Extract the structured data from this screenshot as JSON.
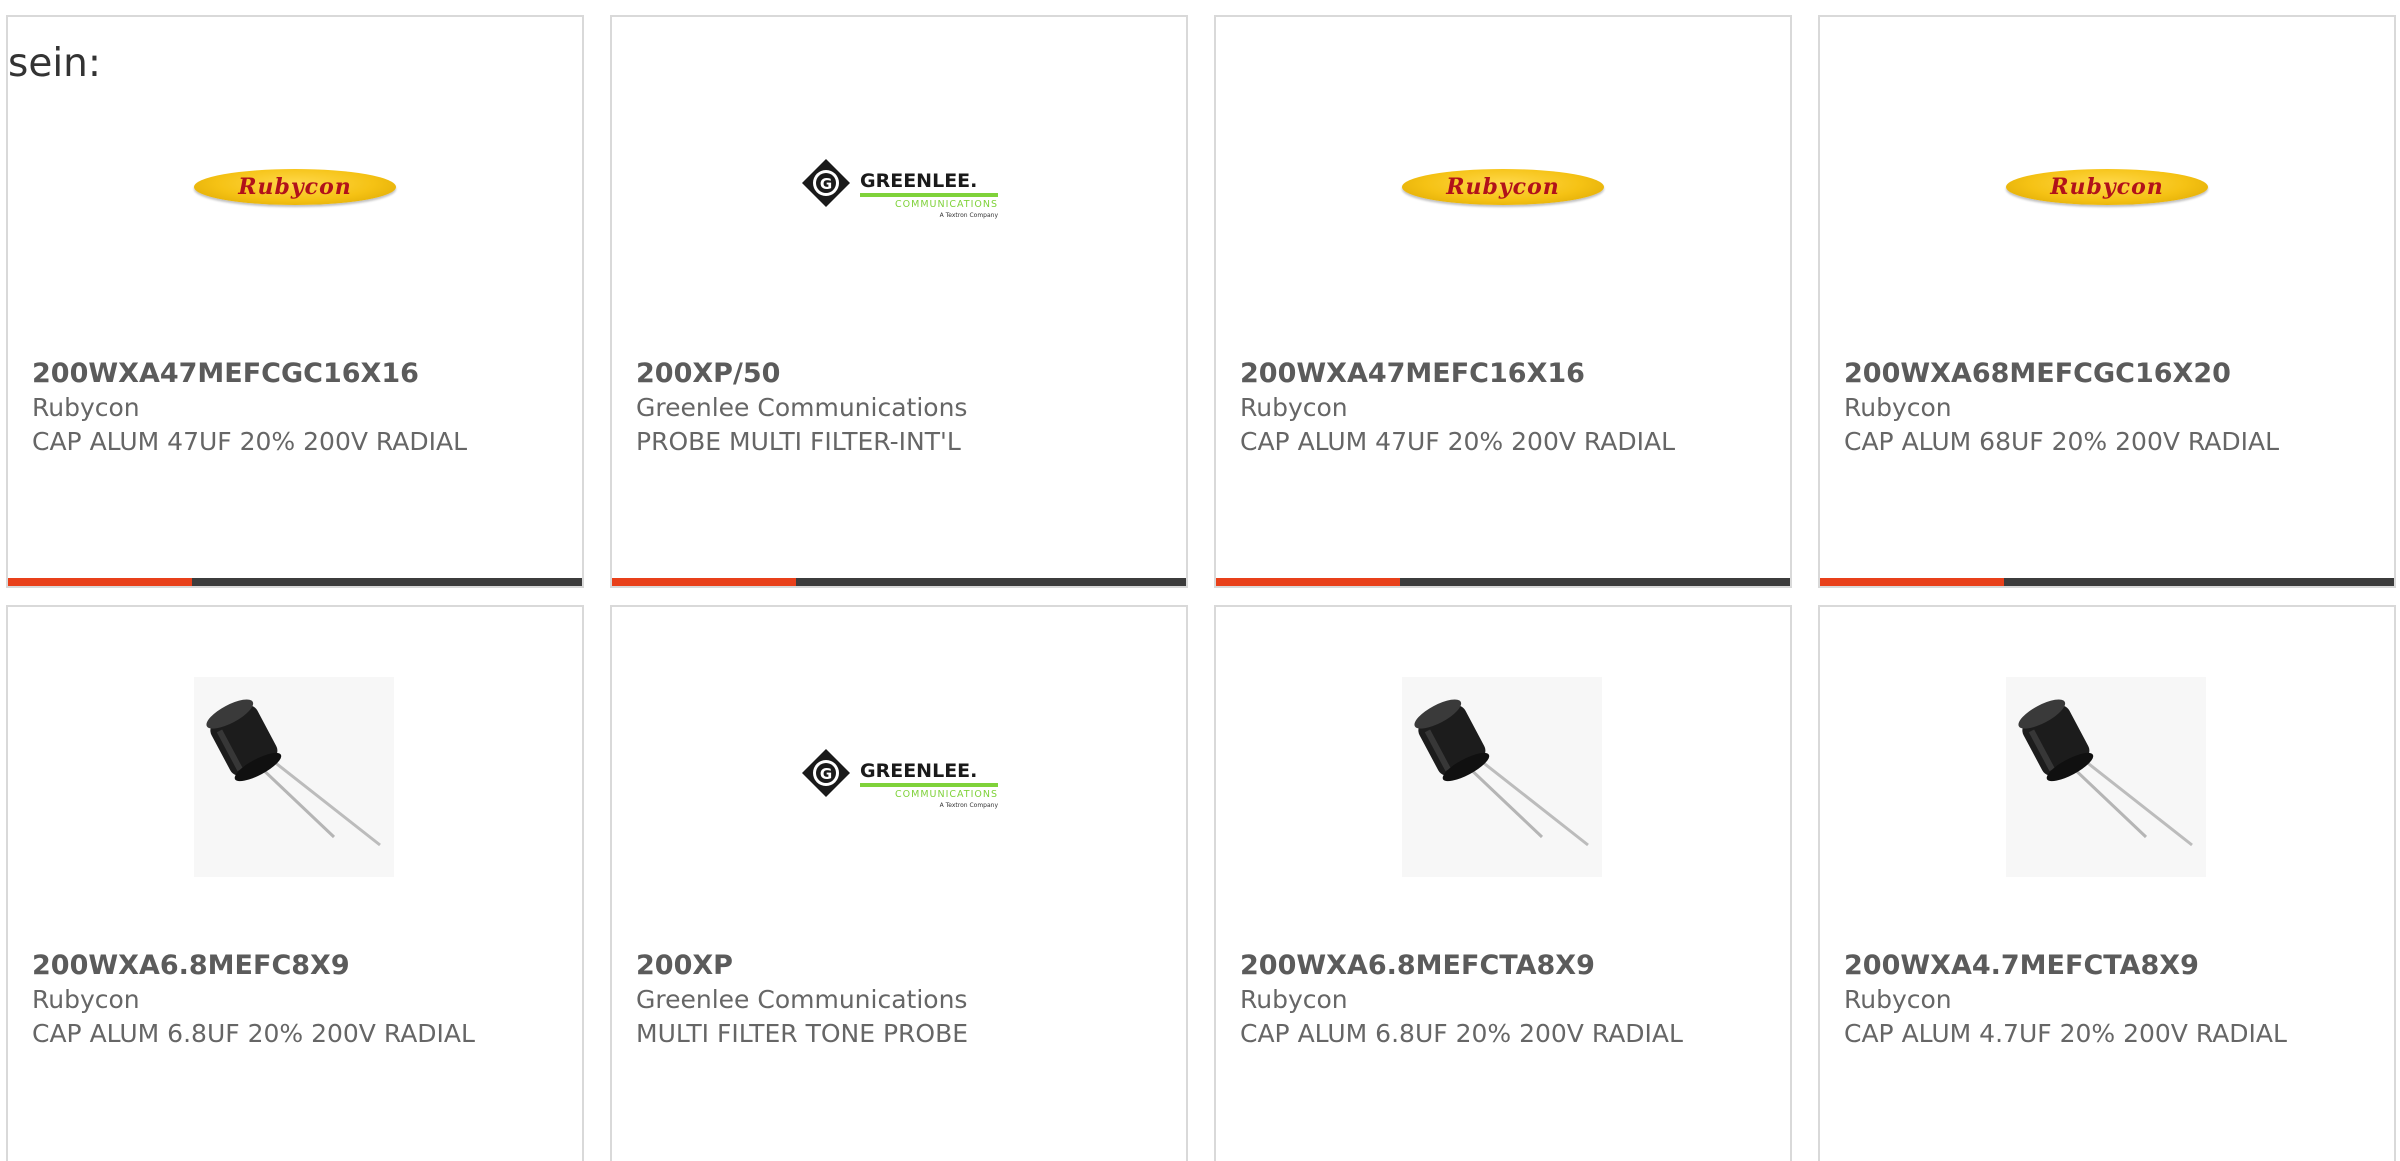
{
  "intro_text": "sein:",
  "colors": {
    "accent_orange": "#e8401a",
    "bar_dark": "#3c3c3c",
    "text_gray": "#666666",
    "border": "#d9d9d9"
  },
  "products": [
    {
      "part_number": "200WXA47MEFCGC16X16",
      "manufacturer": "Rubycon",
      "description": "CAP ALUM 47UF 20% 200V RADIAL",
      "image": "rubycon-logo",
      "logo_text": "Rubycon",
      "progress_fraction": 0.32
    },
    {
      "part_number": "200XP/50",
      "manufacturer": "Greenlee Communications",
      "description": "PROBE MULTI FILTER-INT'L",
      "image": "greenlee-logo",
      "logo_text": "GREENLEE.",
      "logo_sub": "COMMUNICATIONS",
      "logo_tag": "A Textron Company",
      "progress_fraction": 0.32
    },
    {
      "part_number": "200WXA47MEFC16X16",
      "manufacturer": "Rubycon",
      "description": "CAP ALUM 47UF 20% 200V RADIAL",
      "image": "rubycon-logo",
      "logo_text": "Rubycon",
      "progress_fraction": 0.32
    },
    {
      "part_number": "200WXA68MEFCGC16X20",
      "manufacturer": "Rubycon",
      "description": "CAP ALUM 68UF 20% 200V RADIAL",
      "image": "rubycon-logo",
      "logo_text": "Rubycon",
      "progress_fraction": 0.32
    },
    {
      "part_number": "200WXA6.8MEFC8X9",
      "manufacturer": "Rubycon",
      "description": "CAP ALUM 6.8UF 20% 200V RADIAL",
      "image": "capacitor-photo"
    },
    {
      "part_number": "200XP",
      "manufacturer": "Greenlee Communications",
      "description": "MULTI FILTER TONE PROBE",
      "image": "greenlee-logo",
      "logo_text": "GREENLEE.",
      "logo_sub": "COMMUNICATIONS",
      "logo_tag": "A Textron Company"
    },
    {
      "part_number": "200WXA6.8MEFCTA8X9",
      "manufacturer": "Rubycon",
      "description": "CAP ALUM 6.8UF 20% 200V RADIAL",
      "image": "capacitor-photo"
    },
    {
      "part_number": "200WXA4.7MEFCTA8X9",
      "manufacturer": "Rubycon",
      "description": "CAP ALUM 4.7UF 20% 200V RADIAL",
      "image": "capacitor-photo"
    }
  ]
}
